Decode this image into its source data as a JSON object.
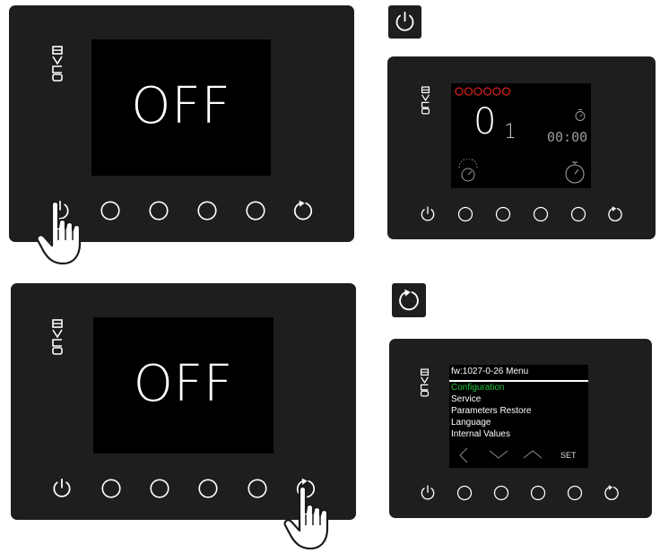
{
  "brand": "EVCO",
  "colors": {
    "panel": "#1e1e1e",
    "screen": "#000000",
    "menu_selected": "#22c53a",
    "status_dots": "#d21e1e"
  },
  "step1": {
    "icon": "power-icon",
    "display_text": "OFF",
    "pressed_button": "power-button"
  },
  "result1": {
    "main_value": "0",
    "sub_value": "1",
    "timer": "00:00",
    "icons": [
      "status-dots-icon",
      "stopwatch-icon",
      "gauge-icon",
      "timer-icon"
    ]
  },
  "step2": {
    "icon": "refresh-icon",
    "display_text": "OFF",
    "pressed_button": "refresh-button"
  },
  "result2": {
    "title": "fw:1027-0-26 Menu",
    "items": [
      {
        "label": "Configuration",
        "selected": true
      },
      {
        "label": "Service",
        "selected": false
      },
      {
        "label": "Parameters Restore",
        "selected": false
      },
      {
        "label": "Language",
        "selected": false
      },
      {
        "label": "Internal Values",
        "selected": false
      }
    ],
    "nav": [
      "chevron-left-icon",
      "chevron-down-icon",
      "chevron-up-icon"
    ],
    "set_label": "SET"
  }
}
